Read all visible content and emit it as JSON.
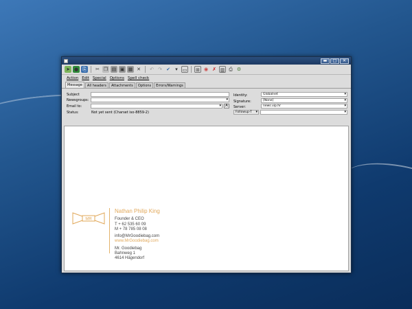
{
  "window": {
    "controls": {
      "minimize": "▬",
      "maximize": "□",
      "close": "✕"
    }
  },
  "toolbar": {
    "icons": [
      "send-icon",
      "send-later-icon",
      "attach-icon",
      "cut-icon",
      "copy-icon",
      "paste-icon",
      "clear-icon",
      "select-icon",
      "delete-icon",
      "undo-icon",
      "redo-icon",
      "spellcheck-icon",
      "insert-file-icon",
      "insert-table-icon",
      "encrypt-icon",
      "sign-icon",
      "address-book-icon",
      "print-icon",
      "security-icon"
    ]
  },
  "menu": {
    "action": "Action",
    "edit": "Edit",
    "special": "Special",
    "options": "Options",
    "spellcheck": "Spell check"
  },
  "tabs": [
    "Message",
    "All headers",
    "Attachments",
    "Options",
    "Errors/Warnings"
  ],
  "form": {
    "subject_label": "Subject",
    "subject_value": "",
    "newsgroups_label": "Newsgroups:",
    "newsgroups_value": "",
    "emailto_label": "Email to:",
    "emailto_value": "",
    "emailto_btn": "A",
    "status_label": "Status:",
    "status_value": "Not yet sent (Charset iso-8859-2)",
    "identity_label": "Identity:",
    "identity_value": "Globalnet",
    "signature_label": "Signature:",
    "signature_value": "[None]",
    "server_label": "Server:",
    "server_value": "news.vip.hr",
    "followup_value": "Followup-T",
    "followup_field": ""
  },
  "signature": {
    "logo_text": "MR",
    "name": "Nathan Philip King",
    "title": "Founder & CEO",
    "phone_t": "T  + 62 535 60 09",
    "phone_m": "M  + 78 785 08 08",
    "email": "info@MrGoodiebag.com",
    "web": "www.MrGoodiebag.com",
    "company": "Mr. Goodiebag",
    "street": "Bahnweg 1",
    "city": "4614 Hägendorf"
  },
  "colors": {
    "accent": "#e1a85a",
    "titlebar": "#1d3a63",
    "desktop": "#23578f"
  }
}
